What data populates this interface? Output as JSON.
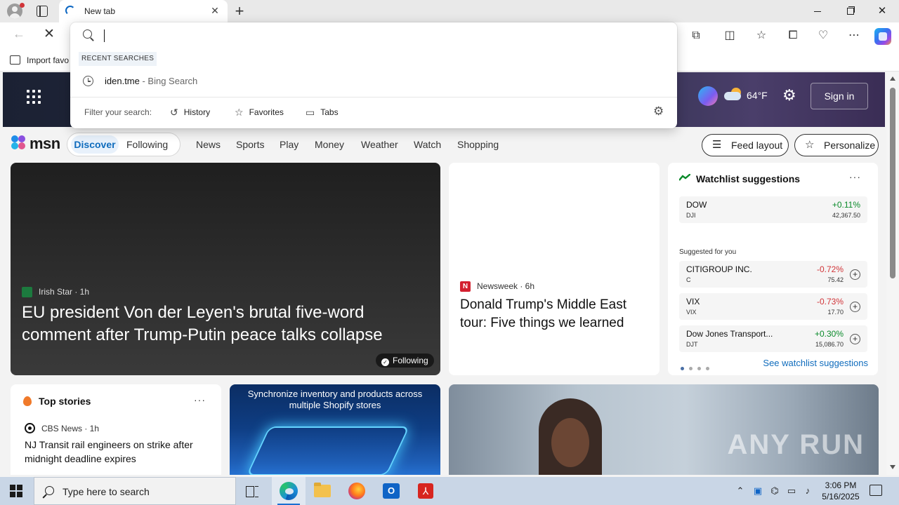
{
  "browser": {
    "tab_title": "New tab",
    "favorites_bar": {
      "import_label": "Import favo"
    }
  },
  "omnibox": {
    "input_value": "",
    "recent_label": "RECENT SEARCHES",
    "recent_items": [
      {
        "query": "iden.tme",
        "suffix": " - Bing Search"
      }
    ],
    "filter_label": "Filter your search:",
    "filters": [
      "History",
      "Favorites",
      "Tabs"
    ]
  },
  "msn": {
    "header": {
      "temperature": "64°F",
      "sign_in": "Sign in"
    },
    "logo_text": "msn",
    "pills": {
      "discover": "Discover",
      "following": "Following"
    },
    "nav_links": [
      "News",
      "Sports",
      "Play",
      "Money",
      "Weather",
      "Watch",
      "Shopping"
    ],
    "feed_layout": "Feed layout",
    "personalize": "Personalize",
    "main_story": {
      "source": "Irish Star · 1h",
      "title": "EU president Von der Leyen's brutal five-word comment after Trump-Putin peace talks collapse",
      "badge": "Following"
    },
    "news_story": {
      "source": "Newsweek · 6h",
      "logo_letter": "N",
      "title": "Donald Trump's Middle East tour: Five things we learned"
    },
    "watchlist": {
      "title": "Watchlist suggestions",
      "suggested_label": "Suggested for you",
      "see_more": "See watchlist suggestions",
      "colors": {
        "up": "#0a8a2a",
        "down": "#d13438"
      },
      "stocks": [
        {
          "name": "DOW",
          "symbol": "DJI",
          "change": "+0.11%",
          "price": "42,367.50",
          "direction": "up",
          "addable": false
        },
        {
          "name": "CITIGROUP INC.",
          "symbol": "C",
          "change": "-0.72%",
          "price": "75.42",
          "direction": "down",
          "addable": true
        },
        {
          "name": "VIX",
          "symbol": "VIX",
          "change": "-0.73%",
          "price": "17.70",
          "direction": "down",
          "addable": true
        },
        {
          "name": "Dow Jones Transport...",
          "symbol": "DJT",
          "change": "+0.30%",
          "price": "15,086.70",
          "direction": "up",
          "addable": true
        }
      ]
    },
    "top_stories": {
      "title": "Top stories",
      "source": "CBS News · 1h",
      "headline": "NJ Transit rail engineers on strike after midnight deadline expires"
    },
    "ad": {
      "text": "Synchronize inventory and products across multiple Shopify stores"
    },
    "photo_watermark": "ANY RUN"
  },
  "taskbar": {
    "search_placeholder": "Type here to search",
    "time": "3:06 PM",
    "date": "5/16/2025"
  }
}
